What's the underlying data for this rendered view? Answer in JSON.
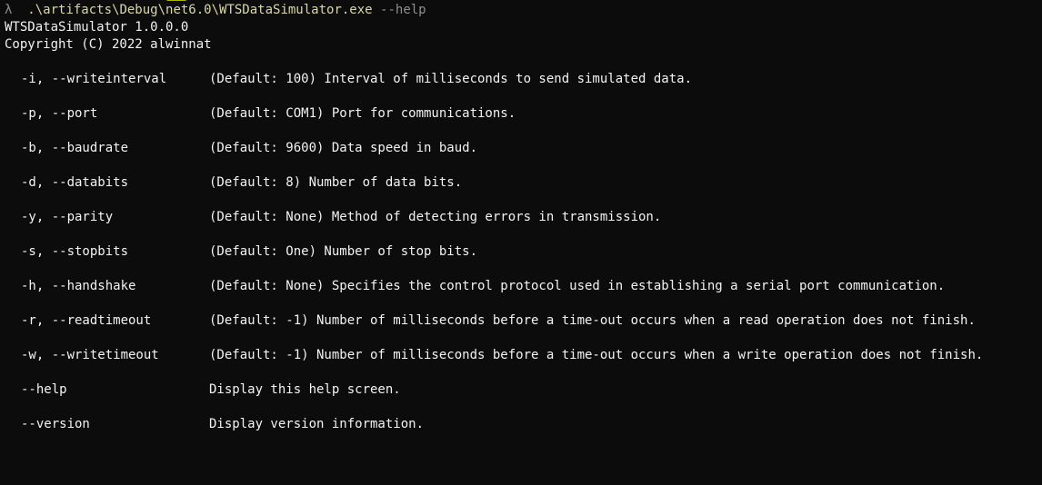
{
  "terminal": {
    "prompt_symbol": "λ",
    "command": ".\\artifacts\\Debug\\net6.0\\WTSDataSimulator.exe",
    "command_arg": "--help",
    "header_line1": "WTSDataSimulator 1.0.0.0",
    "header_line2": "Copyright (C) 2022 alwinnat",
    "options": [
      {
        "flag": "-i, --writeinterval",
        "desc": "(Default: 100) Interval of milliseconds to send simulated data."
      },
      {
        "flag": "-p, --port",
        "desc": "(Default: COM1) Port for communications."
      },
      {
        "flag": "-b, --baudrate",
        "desc": "(Default: 9600) Data speed in baud."
      },
      {
        "flag": "-d, --databits",
        "desc": "(Default: 8) Number of data bits."
      },
      {
        "flag": "-y, --parity",
        "desc": "(Default: None) Method of detecting errors in transmission."
      },
      {
        "flag": "-s, --stopbits",
        "desc": "(Default: One) Number of stop bits."
      },
      {
        "flag": "-h, --handshake",
        "desc": "(Default: None) Specifies the control protocol used in establishing a serial port communication."
      },
      {
        "flag": "-r, --readtimeout",
        "desc": "(Default: -1) Number of milliseconds before a time-out occurs when a read operation does not finish."
      },
      {
        "flag": "-w, --writetimeout",
        "desc": "(Default: -1) Number of milliseconds before a time-out occurs when a write operation does not finish."
      },
      {
        "flag": "--help",
        "desc": "Display this help screen."
      },
      {
        "flag": "--version",
        "desc": "Display version information."
      }
    ]
  }
}
